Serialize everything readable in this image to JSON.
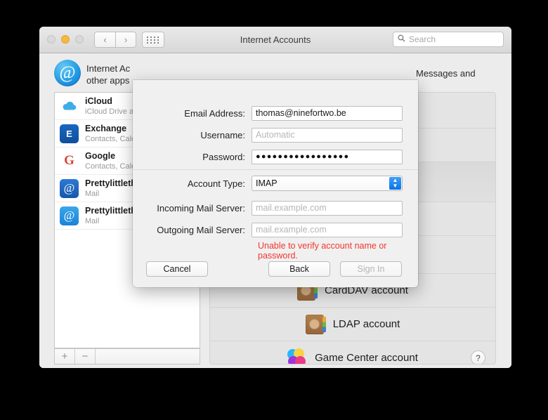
{
  "window": {
    "title": "Internet Accounts",
    "traffic_lights": [
      "close-button",
      "minimize-button",
      "zoom-button"
    ],
    "nav_back": "‹",
    "nav_forward": "›",
    "grid_icon": "all-preferences-icon"
  },
  "search": {
    "placeholder": "Search",
    "icon": "search-icon"
  },
  "header": {
    "icon": "@",
    "line1": "Internet Ac",
    "line2": "other apps",
    "trailing": "Messages and"
  },
  "sidebar": {
    "accounts": [
      {
        "name": "iCloud",
        "subtitle": "iCloud Drive a",
        "icon": "icloud-icon"
      },
      {
        "name": "Exchange",
        "subtitle": "Contacts, Cale",
        "icon": "exchange-icon",
        "glyph": "E"
      },
      {
        "name": "Google",
        "subtitle": "Contacts, Cale",
        "icon": "google-icon",
        "glyph": "G"
      },
      {
        "name": "Prettylittleth",
        "subtitle": "Mail",
        "icon": "mail-account-icon",
        "glyph": "@"
      },
      {
        "name": "Prettylittleth",
        "subtitle": "Mail",
        "icon": "mail-account-icon",
        "glyph": "@"
      }
    ],
    "add_label": "+",
    "remove_label": "−"
  },
  "right_pane": {
    "rows": [
      {
        "label": "CardDAV account",
        "icon": "contacts-card-icon"
      },
      {
        "label": "LDAP account",
        "icon": "contacts-card-icon"
      },
      {
        "label": "Game Center account",
        "icon": "game-center-icon"
      }
    ],
    "help_label": "?"
  },
  "sheet": {
    "fields": [
      {
        "label": "Email Address:",
        "value": "thomas@ninefortwo.be",
        "placeholder": ""
      },
      {
        "label": "Username:",
        "value": "",
        "placeholder": "Automatic"
      },
      {
        "label": "Password:",
        "value": "●●●●●●●●●●●●●●●●●",
        "placeholder": ""
      }
    ],
    "account_type": {
      "label": "Account Type:",
      "value": "IMAP"
    },
    "servers": [
      {
        "label": "Incoming Mail Server:",
        "value": "",
        "placeholder": "mail.example.com"
      },
      {
        "label": "Outgoing Mail Server:",
        "value": "",
        "placeholder": "mail.example.com"
      }
    ],
    "error": "Unable to verify account name or password.",
    "buttons": {
      "cancel": "Cancel",
      "back": "Back",
      "signin": "Sign In"
    }
  },
  "colors": {
    "error_red": "#f4362e",
    "accent_blue": "#0a74e6",
    "window_bg": "#ececec"
  }
}
